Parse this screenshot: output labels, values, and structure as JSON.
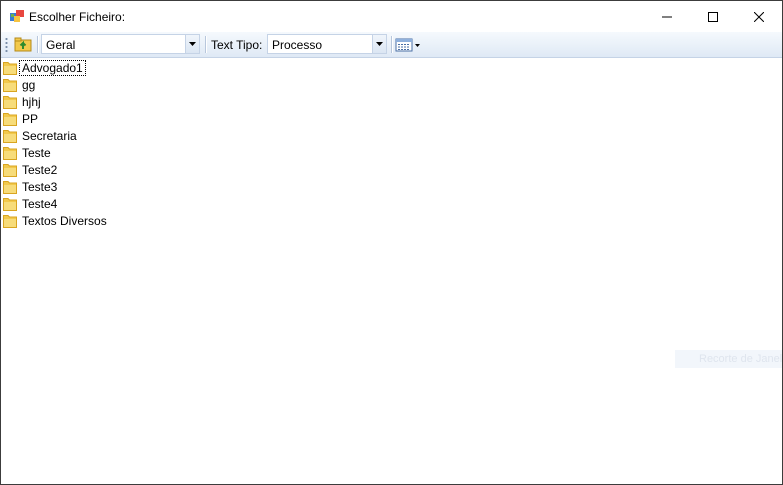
{
  "window": {
    "title": "Escolher Ficheiro:"
  },
  "toolbar": {
    "location_value": "Geral",
    "type_label": "Text Tipo:",
    "type_value": "Processo"
  },
  "files": [
    {
      "name": "Advogado1",
      "icon": "folder-icon"
    },
    {
      "name": "gg",
      "icon": "folder-icon"
    },
    {
      "name": "hjhj",
      "icon": "folder-icon"
    },
    {
      "name": "PP",
      "icon": "folder-icon"
    },
    {
      "name": "Secretaria",
      "icon": "folder-icon"
    },
    {
      "name": "Teste",
      "icon": "folder-icon"
    },
    {
      "name": "Teste2",
      "icon": "folder-icon"
    },
    {
      "name": "Teste3",
      "icon": "folder-icon"
    },
    {
      "name": "Teste4",
      "icon": "folder-icon"
    },
    {
      "name": "Textos Diversos",
      "icon": "folder-icon"
    }
  ],
  "overlay": {
    "ghost_text": "Recorte de Janela"
  },
  "colors": {
    "toolbar_top": "#f5f9fd",
    "toolbar_bottom": "#dfe9f5",
    "folder": "#f4cf5c"
  }
}
